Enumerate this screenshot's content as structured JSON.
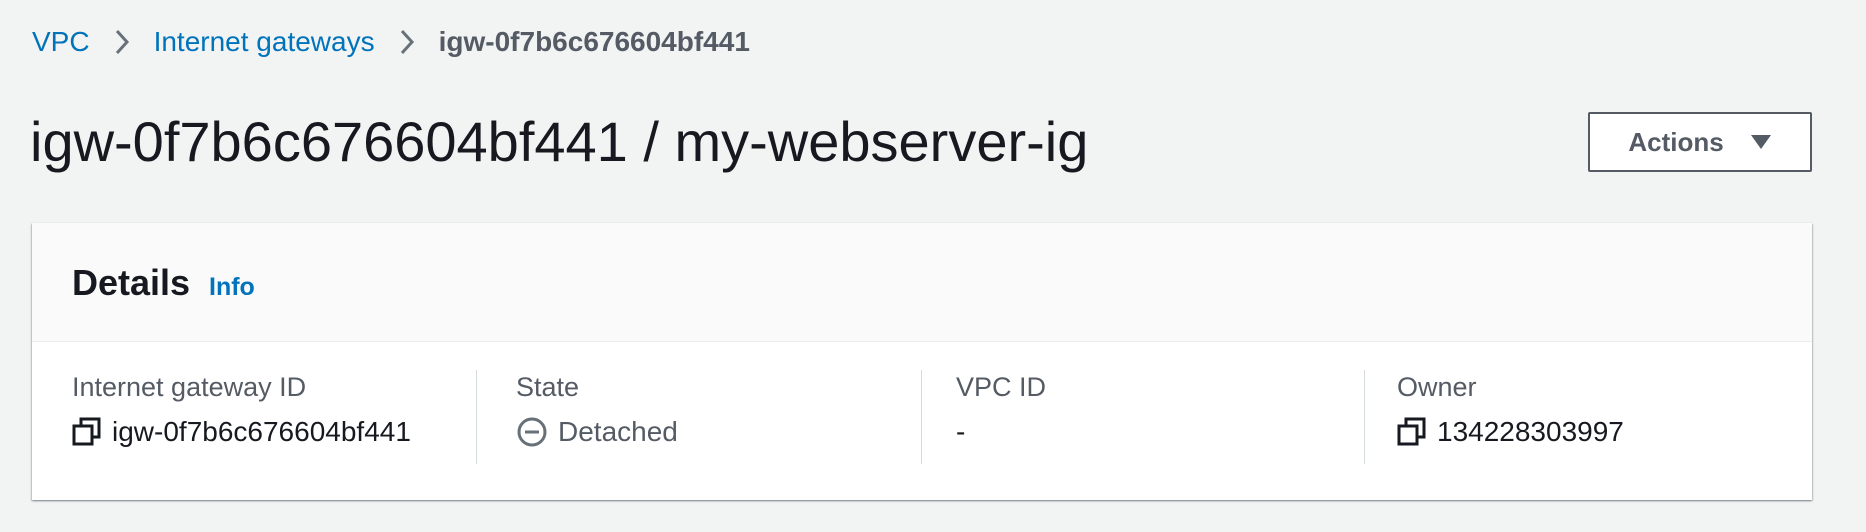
{
  "breadcrumb": {
    "items": [
      {
        "label": "VPC"
      },
      {
        "label": "Internet gateways"
      },
      {
        "label": "igw-0f7b6c676604bf441"
      }
    ]
  },
  "header": {
    "title": "igw-0f7b6c676604bf441 / my-webserver-ig",
    "actions_label": "Actions"
  },
  "details": {
    "title": "Details",
    "info_label": "Info",
    "fields": [
      {
        "label": "Internet gateway ID",
        "value": "igw-0f7b6c676604bf441",
        "icon": "copy-icon"
      },
      {
        "label": "State",
        "value": "Detached",
        "icon": "detached-status-icon"
      },
      {
        "label": "VPC ID",
        "value": "-"
      },
      {
        "label": "Owner",
        "value": "134228303997",
        "icon": "copy-icon"
      }
    ]
  },
  "colors": {
    "link": "#0073bb",
    "text": "#16191f",
    "muted": "#545b64",
    "background": "#f2f3f3"
  }
}
